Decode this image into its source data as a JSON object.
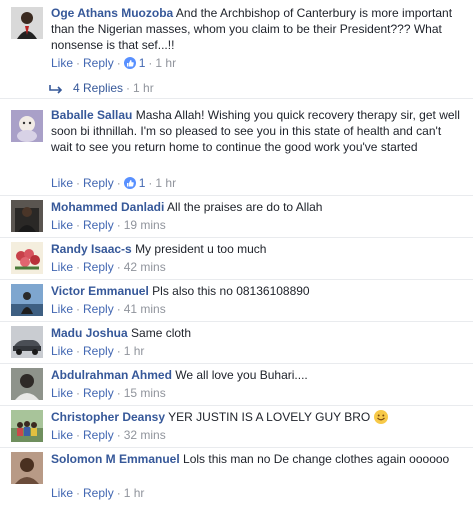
{
  "comments": [
    {
      "author": "Oge Athans Muozoba",
      "text": "And the Archbishop of Canterbury is more important than the Nigerian masses, whom you claim to be their President??? What nonsense is that sef...!!",
      "like": "Like",
      "reply": "Reply",
      "reaction_count": "1",
      "time": "1 hr",
      "avatar_color": "#2b2b2b"
    },
    {
      "author": "Baballe Sallau",
      "text": "Masha Allah! Wishing you quick recovery therapy sir, get well soon bi ithnillah. I'm so pleased to see you in this state of health and can't wait to see you return home to continue the good work you've started",
      "like": "Like",
      "reply": "Reply",
      "reaction_count": "1",
      "time": "1 hr",
      "avatar_color": "#8a7ca8"
    },
    {
      "author": "Mohammed Danladi",
      "text": "All the praises are do to Allah",
      "like": "Like",
      "reply": "Reply",
      "time": "19 mins",
      "avatar_color": "#3b3a36"
    },
    {
      "author": "Randy Isaac-s",
      "text": "My president u too much",
      "like": "Like",
      "reply": "Reply",
      "time": "42 mins",
      "avatar_color": "#c8414a"
    },
    {
      "author": "Victor Emmanuel",
      "text": "Pls also this no 08136108890",
      "like": "Like",
      "reply": "Reply",
      "time": "41 mins",
      "avatar_color": "#4d6e94"
    },
    {
      "author": "Madu Joshua",
      "text": "Same cloth",
      "like": "Like",
      "reply": "Reply",
      "time": "1 hr",
      "avatar_color": "#7b7f85"
    },
    {
      "author": "Abdulrahman Ahmed",
      "text": "We all love you Buhari....",
      "like": "Like",
      "reply": "Reply",
      "time": "15 mins",
      "avatar_color": "#5a5f57"
    },
    {
      "author": "Christopher Deansy",
      "text": "YER JUSTIN IS A LOVELY GUY BRO",
      "like": "Like",
      "reply": "Reply",
      "time": "32 mins",
      "avatar_color": "#7a9a6a",
      "emoji": "smiling-face-emoji"
    },
    {
      "author": "Solomon M Emmanuel",
      "text": "Lols this man no De change clothes again oooooo",
      "like": "Like",
      "reply": "Reply",
      "time": "1 hr",
      "avatar_color": "#8a6a55"
    }
  ],
  "replies_link": {
    "label": "4 Replies",
    "time": "1 hr",
    "icon": "reply-arrow-icon"
  },
  "colors": {
    "author": "#365899",
    "link": "#4267b2",
    "meta": "#90949c",
    "like_badge": "#5890ff"
  }
}
